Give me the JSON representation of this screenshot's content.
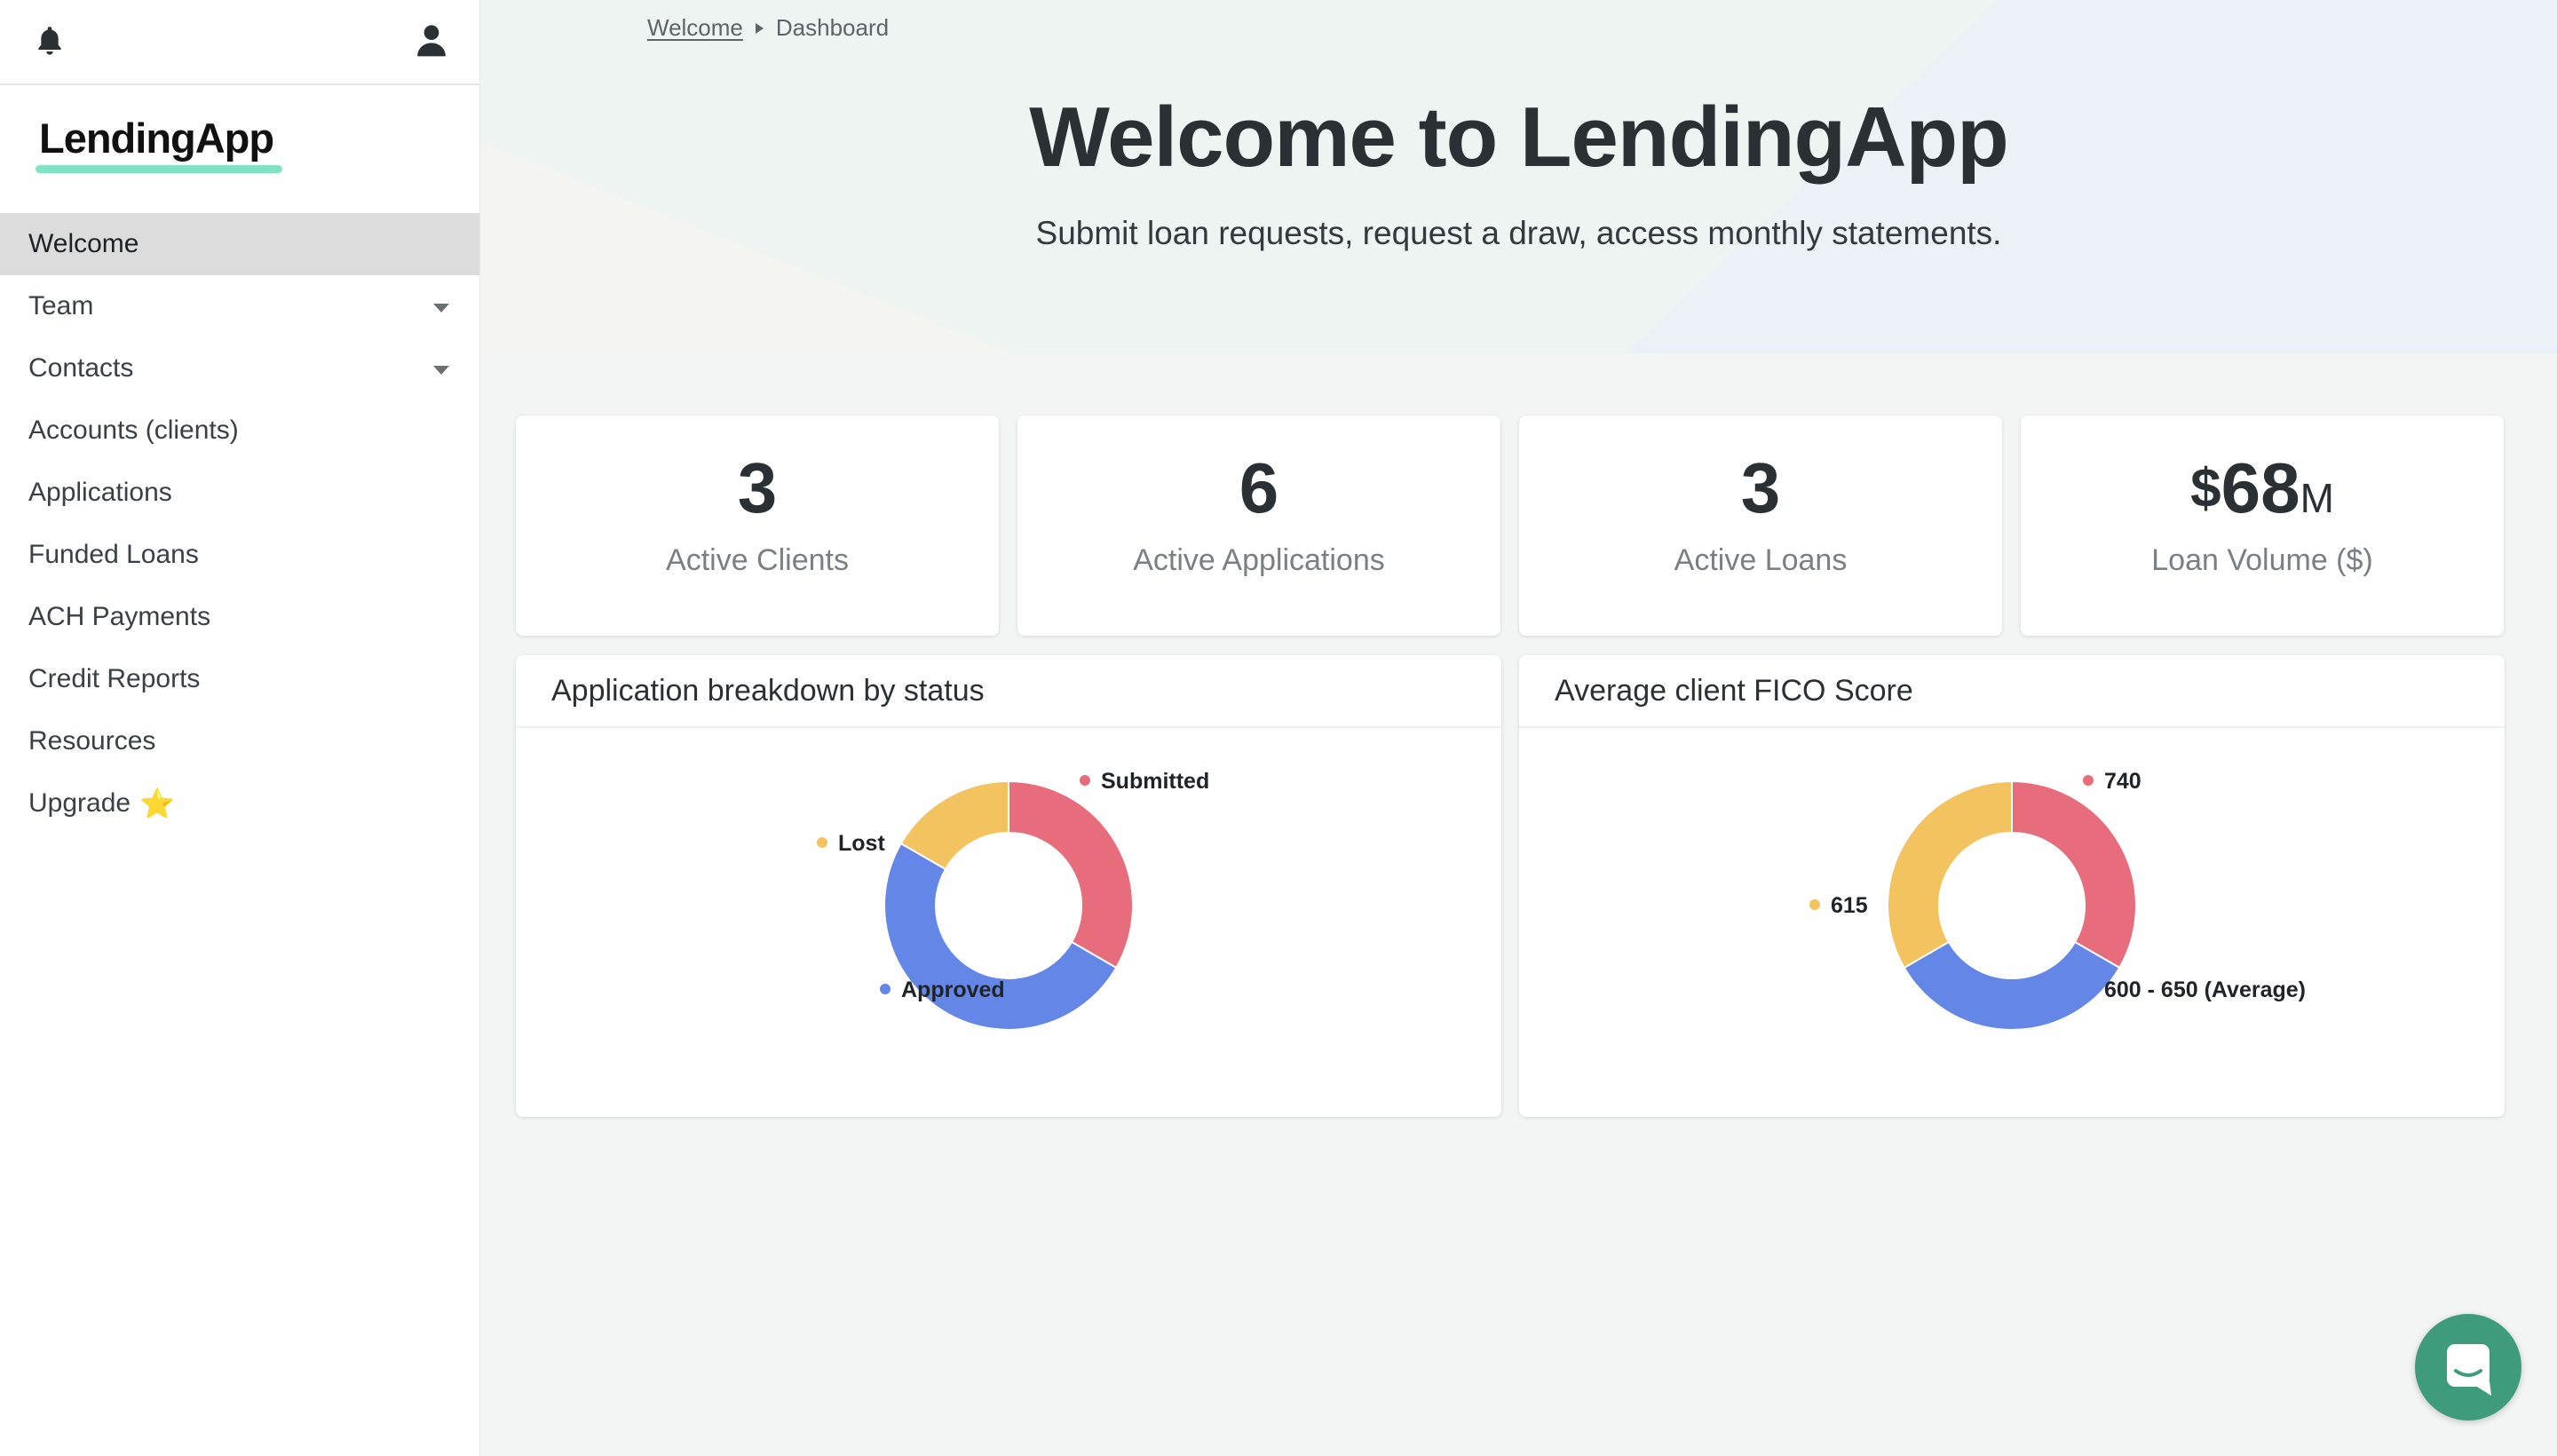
{
  "app": {
    "name": "LendingApp"
  },
  "icons": {
    "bell": "bell-icon",
    "user": "user-icon",
    "chat": "chat-icon",
    "star": "star-icon"
  },
  "colors": {
    "red": "#e76d7c",
    "yellow": "#f3c35f",
    "blue": "#6486e6",
    "accent": "#7fe3c4",
    "chat": "#3e9b7c"
  },
  "sidebar": {
    "items": [
      {
        "label": "Welcome",
        "active": true,
        "caret": false
      },
      {
        "label": "Team",
        "active": false,
        "caret": true
      },
      {
        "label": "Contacts",
        "active": false,
        "caret": true
      },
      {
        "label": "Accounts (clients)",
        "active": false,
        "caret": false
      },
      {
        "label": "Applications",
        "active": false,
        "caret": false
      },
      {
        "label": "Funded Loans",
        "active": false,
        "caret": false
      },
      {
        "label": "ACH Payments",
        "active": false,
        "caret": false
      },
      {
        "label": "Credit Reports",
        "active": false,
        "caret": false
      },
      {
        "label": "Resources",
        "active": false,
        "caret": false
      },
      {
        "label": "Upgrade",
        "active": false,
        "caret": false,
        "star": "⭐"
      }
    ]
  },
  "breadcrumb": {
    "link": "Welcome",
    "current": "Dashboard"
  },
  "hero": {
    "title": "Welcome to LendingApp",
    "subtitle": "Submit loan requests, request a draw, access monthly statements."
  },
  "stats": [
    {
      "value": "3",
      "label": "Active Clients"
    },
    {
      "value": "6",
      "label": "Active Applications"
    },
    {
      "value": "3",
      "label": "Active Loans"
    },
    {
      "prefix": "$",
      "value": "68",
      "suffix": "M",
      "label": "Loan Volume ($)"
    }
  ],
  "charts": {
    "status_title": "Application breakdown by status",
    "fico_title": "Average client FICO Score"
  },
  "chart_data": [
    {
      "type": "pie",
      "title": "Application breakdown by status",
      "categories": [
        "Submitted",
        "Approved",
        "Lost"
      ],
      "values": [
        2,
        3,
        1
      ],
      "colors": [
        "#e76d7c",
        "#6486e6",
        "#f3c35f"
      ]
    },
    {
      "type": "pie",
      "title": "Average client FICO Score",
      "categories": [
        "740",
        "600 - 650 (Average)",
        "615"
      ],
      "values": [
        1,
        1,
        1
      ],
      "colors": [
        "#e76d7c",
        "#6486e6",
        "#f3c35f"
      ]
    }
  ]
}
